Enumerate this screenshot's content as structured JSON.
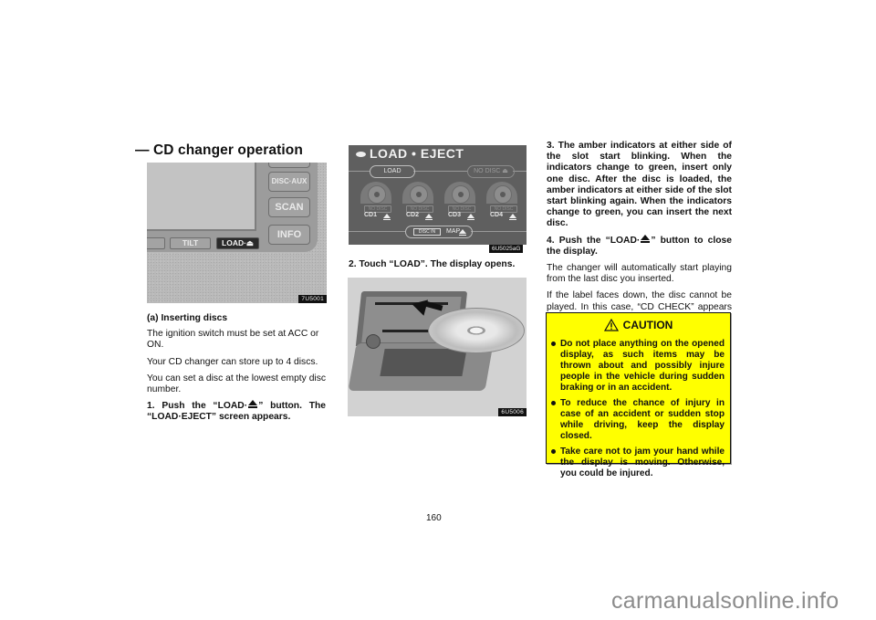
{
  "section_title": "— CD changer operation",
  "figures": {
    "fig1": {
      "label": "7U5001",
      "buttons": {
        "disc_aux": "DISC·AUX",
        "scan": "SCAN",
        "info": "INFO",
        "tilt": "TILT",
        "load": "LOAD·⏏"
      }
    },
    "fig2": {
      "label": "6U5025aG",
      "title": "LOAD • EJECT",
      "load_button": "LOAD",
      "no_disc_top": "NO DISC ⏏",
      "slots": [
        {
          "status": "NO DISC",
          "name": "CD1"
        },
        {
          "status": "NO DISC",
          "name": "CD2"
        },
        {
          "status": "NO DISC",
          "name": "CD3"
        },
        {
          "status": "NO DISC",
          "name": "CD4"
        }
      ],
      "disc_in": "DISC IN",
      "map": "MAP"
    },
    "fig3": {
      "label": "6U5006"
    }
  },
  "col1": {
    "subheading": "(a)   Inserting discs",
    "p1": "The ignition switch must be set at ACC or ON.",
    "p2": "Your CD changer can store up to 4 discs.",
    "p3": "You can set a disc at the lowest empty disc number.",
    "step1_a": "1.  Push the “LOAD·",
    "step1_b": "” button.   The “LOAD·EJECT” screen appears."
  },
  "col2": {
    "step2": "2.  Touch “LOAD”.  The display opens."
  },
  "col3": {
    "step3": "3.  The amber indicators at either side of the slot start blinking.  When the indicators change to green, insert only one disc. After the disc is loaded, the amber indicators at either side of the slot start blinking again.  When the indicators change to green, you can insert the next disc.",
    "step4_a": "4.  Push the “LOAD·",
    "step4_b": "” button to close the display.",
    "p1": "The changer will automatically start playing from the last disc you inserted.",
    "p2": "If the label faces down, the disc cannot be played.  In this case, “CD CHECK” appears on the screen."
  },
  "caution": {
    "title": "CAUTION",
    "color": "#ffff00",
    "items": [
      "Do not place anything on the opened display, as such items may be thrown about and possibly injure people in the vehicle during sudden braking or in an accident.",
      "To reduce the chance of injury in case of an accident or sudden stop while driving, keep the display closed.",
      "Take care not to jam your hand while the display is moving.  Otherwise, you could be injured."
    ]
  },
  "page_number": "160",
  "watermark": "carmanualsonline.info"
}
